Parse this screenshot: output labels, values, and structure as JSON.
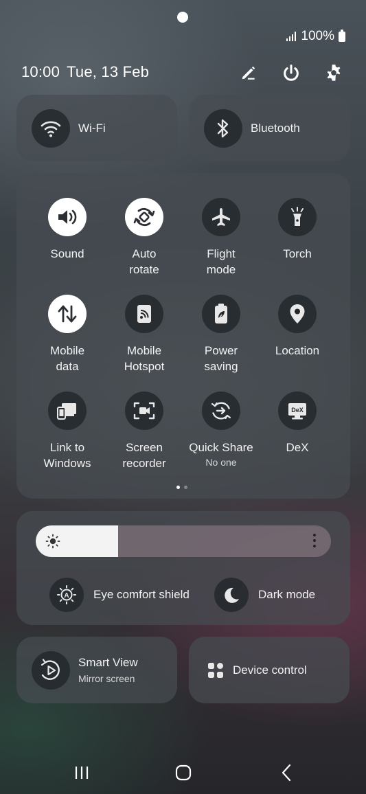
{
  "status": {
    "battery": "100%"
  },
  "header": {
    "time": "10:00",
    "date": "Tue, 13 Feb"
  },
  "tiles_top": {
    "wifi": "Wi-Fi",
    "bluetooth": "Bluetooth"
  },
  "quick_tiles": [
    {
      "id": "sound",
      "label": "Sound",
      "on": true,
      "icon": "speaker-icon"
    },
    {
      "id": "auto-rotate",
      "label": "Auto rotate",
      "on": true,
      "icon": "rotate-icon"
    },
    {
      "id": "flight-mode",
      "label": "Flight mode",
      "on": false,
      "icon": "airplane-icon"
    },
    {
      "id": "torch",
      "label": "Torch",
      "on": false,
      "icon": "flashlight-icon"
    },
    {
      "id": "mobile-data",
      "label": "Mobile data",
      "on": true,
      "icon": "data-arrows-icon"
    },
    {
      "id": "mobile-hotspot",
      "label": "Mobile Hotspot",
      "on": false,
      "icon": "hotspot-icon"
    },
    {
      "id": "power-saving",
      "label": "Power saving",
      "on": false,
      "icon": "battery-leaf-icon"
    },
    {
      "id": "location",
      "label": "Location",
      "on": false,
      "icon": "location-pin-icon"
    },
    {
      "id": "link-to-windows",
      "label": "Link to Windows",
      "on": false,
      "icon": "link-windows-icon"
    },
    {
      "id": "screen-recorder",
      "label": "Screen recorder",
      "on": false,
      "icon": "screen-record-icon"
    },
    {
      "id": "quick-share",
      "label": "Quick Share",
      "sub": "No one",
      "on": false,
      "icon": "quick-share-icon"
    },
    {
      "id": "dex",
      "label": "DeX",
      "on": false,
      "icon": "dex-icon"
    }
  ],
  "page_indicator": {
    "current": 1,
    "total": 2
  },
  "brightness": {
    "level": 0.28
  },
  "toggles": {
    "eye_comfort": "Eye comfort shield",
    "dark_mode": "Dark mode"
  },
  "smart_view": {
    "title": "Smart View",
    "sub": "Mirror screen"
  },
  "device_control": {
    "label": "Device control"
  },
  "colors": {
    "tile_on": "#ffffff",
    "tile_off": "#23282c",
    "icon_on": "#2b2f33",
    "icon_off": "#e8e8e8"
  }
}
